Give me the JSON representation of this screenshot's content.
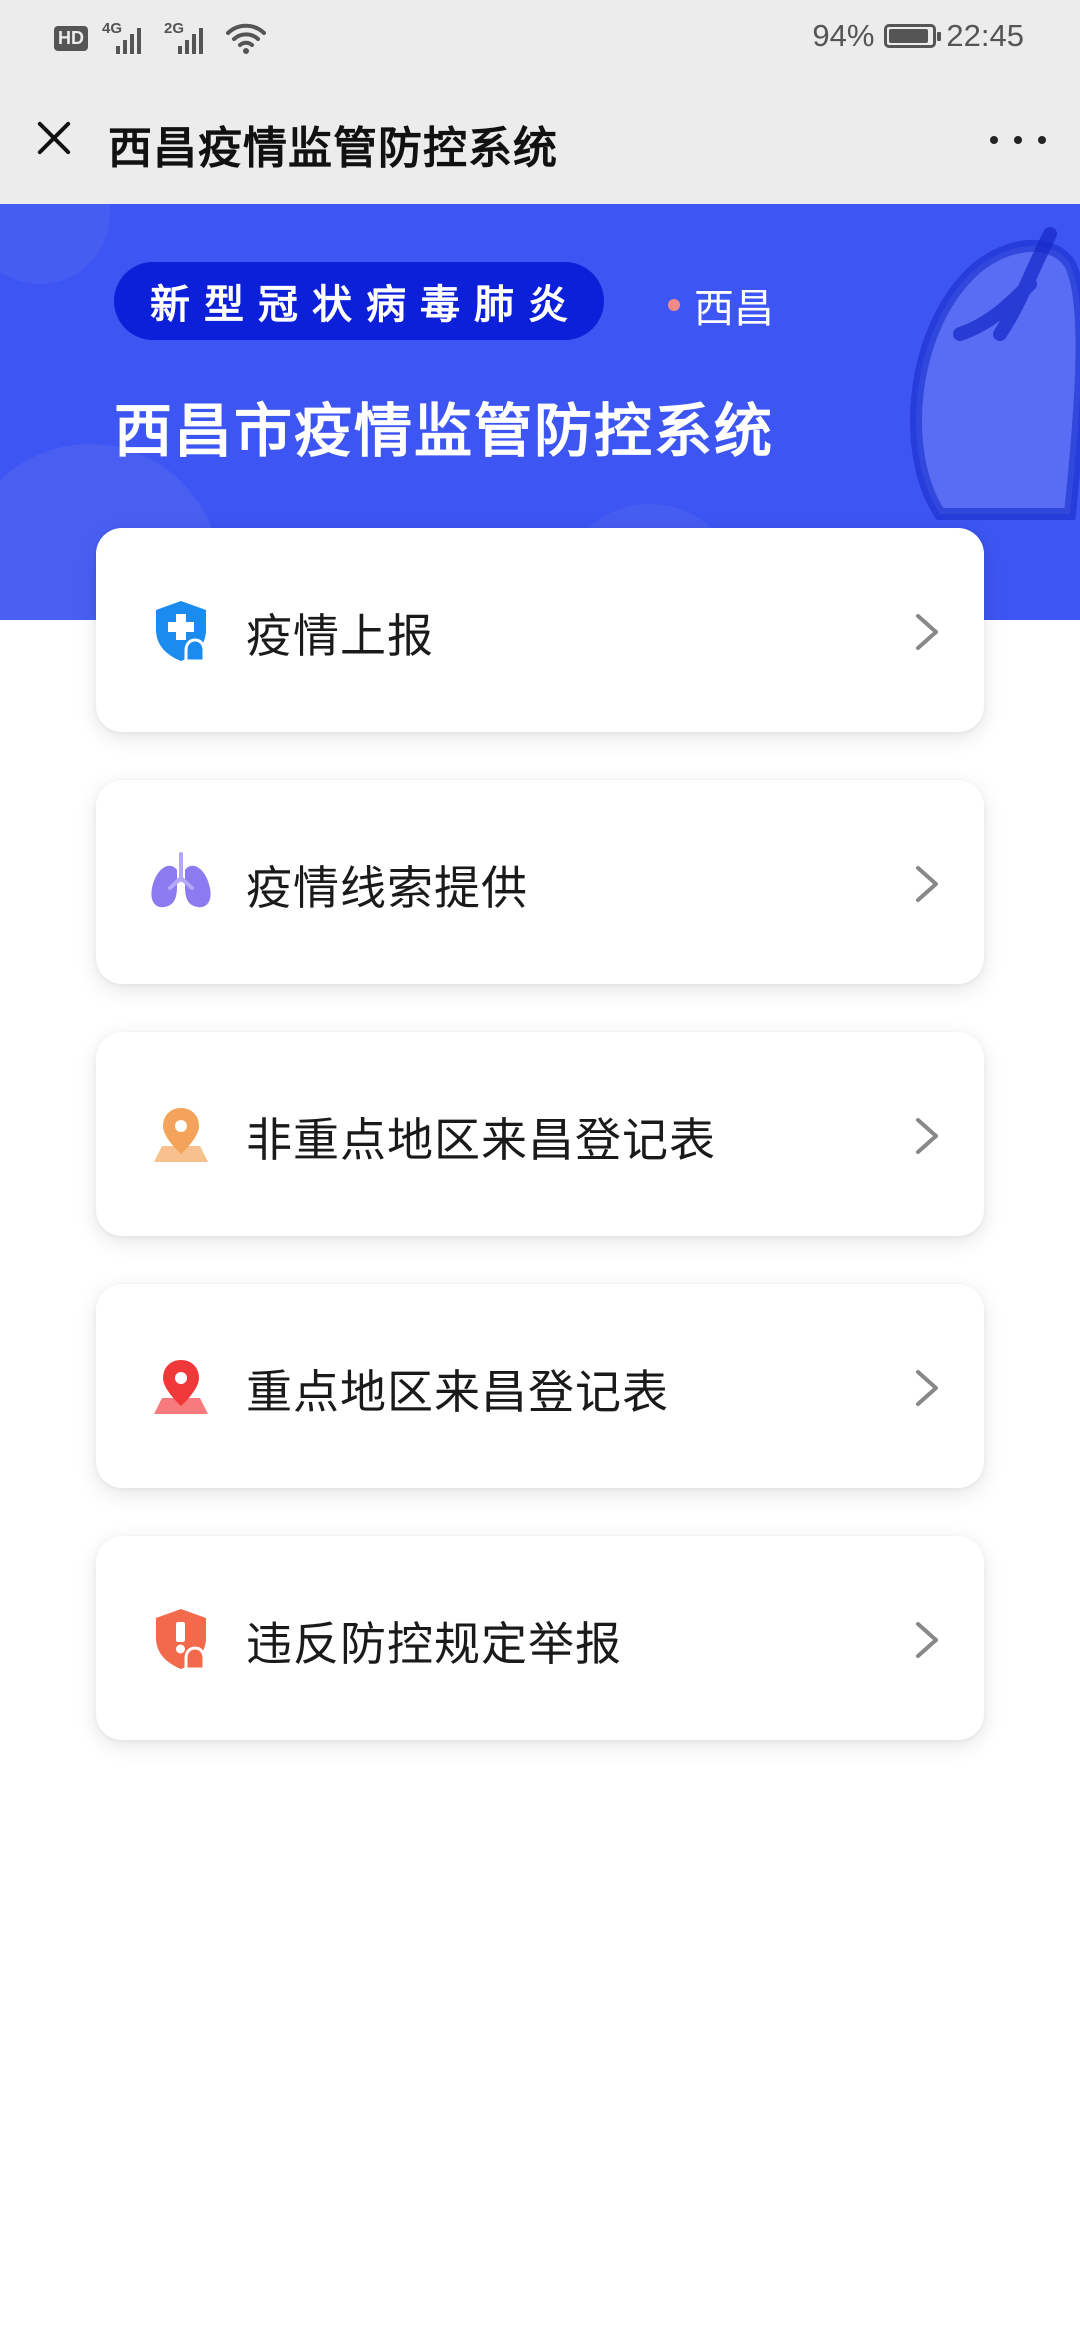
{
  "status_bar": {
    "hd_badge": "HD",
    "net1": "4G",
    "net2": "2G",
    "battery_percent": "94%",
    "battery_level": 0.94,
    "time": "22:45"
  },
  "title_bar": {
    "title": "西昌疫情监管防控系统",
    "close_icon": "close-icon",
    "more_icon": "more-icon"
  },
  "banner": {
    "pill_text": "新型冠状病毒肺炎",
    "location": "西昌",
    "title": "西昌市疫情监管防控系统",
    "background_color": "#3d55f2",
    "pill_color": "#0c1fd9"
  },
  "menu": {
    "items": [
      {
        "label": "疫情上报",
        "icon": "shield-medical-icon",
        "icon_color": "#1a8cf0"
      },
      {
        "label": "疫情线索提供",
        "icon": "lungs-icon",
        "icon_color": "#8b7bf0"
      },
      {
        "label": "非重点地区来昌登记表",
        "icon": "location-pin-icon",
        "icon_color": "#f4a35a"
      },
      {
        "label": "重点地区来昌登记表",
        "icon": "location-pin-icon",
        "icon_color": "#f0373a"
      },
      {
        "label": "违反防控规定举报",
        "icon": "shield-alert-icon",
        "icon_color": "#f26a4b"
      }
    ],
    "chevron_icon": "chevron-right-icon"
  }
}
